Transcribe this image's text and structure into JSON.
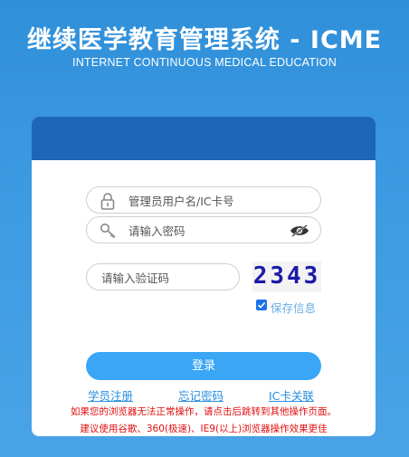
{
  "header": {
    "title": "继续医学教育管理系统 - ICME",
    "subtitle": "INTERNET CONTINUOUS MEDICAL EDUCATION"
  },
  "login_form": {
    "username_placeholder": "管理员用户名/IC卡号",
    "password_placeholder": "请输入密码",
    "captcha_placeholder": "请输入验证码",
    "captcha_text": "2343",
    "remember_label": "保存信息",
    "remember_checked": true,
    "login_button": "登录"
  },
  "links": {
    "register": "学员注册",
    "forgot_password": "忘记密码",
    "ic_card_link": "IC卡关联"
  },
  "notices": [
    "如果您的浏览器无法正常操作，请点击后跳转到其他操作页面。",
    "建议使用谷歌、360(极速)、IE9(以上)浏览器操作效果更佳"
  ],
  "colors": {
    "background": "#3d9be2",
    "panel_header": "#1e66b8",
    "button": "#3aa6f5",
    "link": "#2a8ee0",
    "notice": "#e01010"
  },
  "icons": {
    "username": "lock-icon",
    "password": "key-icon",
    "toggle_password": "eye-icon"
  }
}
